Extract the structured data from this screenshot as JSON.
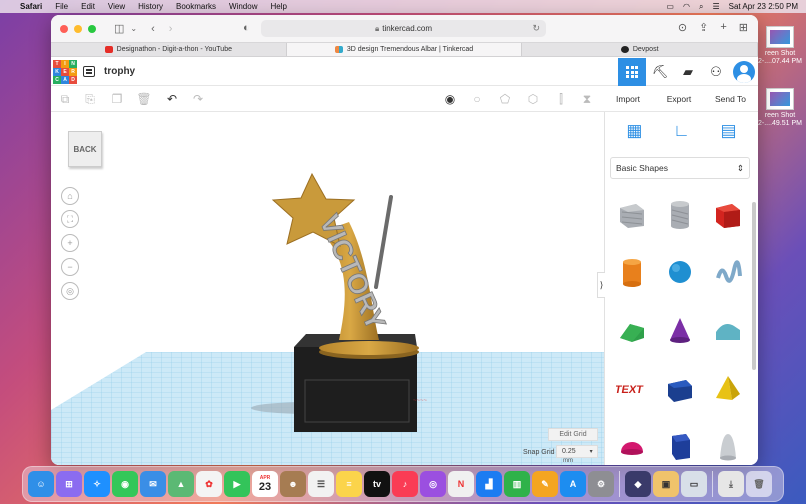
{
  "menubar": {
    "app": "Safari",
    "items": [
      "File",
      "Edit",
      "View",
      "History",
      "Bookmarks",
      "Window",
      "Help"
    ],
    "datetime": "Sat Apr 23  2:50 PM"
  },
  "browser": {
    "url": "tinkercad.com",
    "tabs": [
      {
        "title": "Designathon - Digit-a-thon - YouTube",
        "favicon": "youtube-icon"
      },
      {
        "title": "3D design Tremendous Albar | Tinkercad",
        "favicon": "tinkercad-icon"
      },
      {
        "title": "Devpost",
        "favicon": "devpost-icon"
      }
    ]
  },
  "tinkercad": {
    "logo_letters": [
      "T",
      "I",
      "N",
      "K",
      "E",
      "R",
      "C",
      "A",
      "D"
    ],
    "design_title": "trophy",
    "actions": {
      "import": "Import",
      "export": "Export",
      "send_to": "Send To"
    },
    "back_label": "BACK",
    "edit_grid": "Edit Grid",
    "snap_grid_label": "Snap Grid",
    "snap_grid_value": "0.25",
    "snap_grid_unit": "mm",
    "shape_library": "Basic Shapes",
    "trophy_text": "VICTORY",
    "shapes": [
      "box-striped",
      "cylinder-striped",
      "box",
      "cylinder",
      "sphere",
      "scribble",
      "roof",
      "cone",
      "round-roof",
      "text",
      "prism",
      "pyramid",
      "half-sphere",
      "polygon",
      "paraboloid"
    ]
  },
  "desktop": {
    "files": [
      {
        "line1": "reen Shot",
        "line2": "2-....07.44 PM"
      },
      {
        "line1": "reen Shot",
        "line2": "2-....49.51 PM"
      }
    ]
  },
  "dock": {
    "calendar_month": "APR",
    "calendar_day": "23"
  }
}
